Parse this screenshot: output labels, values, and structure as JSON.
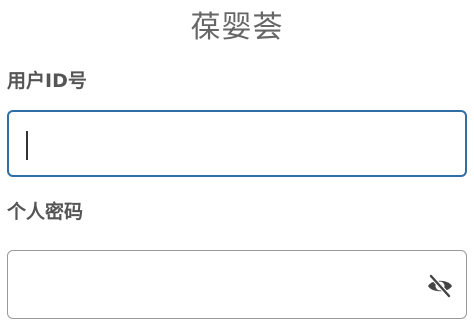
{
  "form": {
    "title": "葆婴荟",
    "userid": {
      "label": "用户ID号",
      "value": "",
      "placeholder": ""
    },
    "password": {
      "label": "个人密码",
      "value": "",
      "placeholder": ""
    },
    "icons": {
      "password_toggle": "eye-slash-icon"
    }
  },
  "colors": {
    "focus_border": "#2f6fa5",
    "default_border": "#9a9a9a",
    "title_text": "#666666",
    "label_text": "#555555",
    "icon": "#444444"
  }
}
